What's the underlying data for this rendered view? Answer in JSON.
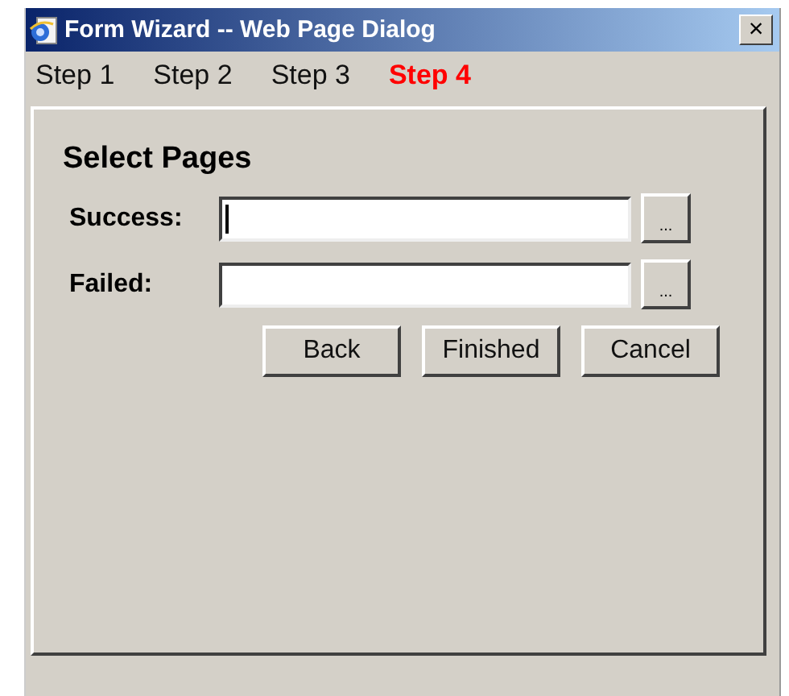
{
  "window": {
    "title": "Form Wizard -- Web Page Dialog",
    "close": "×"
  },
  "steps": [
    {
      "label": "Step 1",
      "selected": false
    },
    {
      "label": "Step 2",
      "selected": false
    },
    {
      "label": "Step 3",
      "selected": false
    },
    {
      "label": "Step 4",
      "selected": true
    }
  ],
  "panel": {
    "heading": "Select Pages",
    "fields": [
      {
        "label": "Success:",
        "focused": true,
        "browse": "..."
      },
      {
        "label": "Failed:",
        "focused": false,
        "browse": "..."
      }
    ],
    "buttons": [
      "Back",
      "Finished",
      "Cancel"
    ]
  }
}
